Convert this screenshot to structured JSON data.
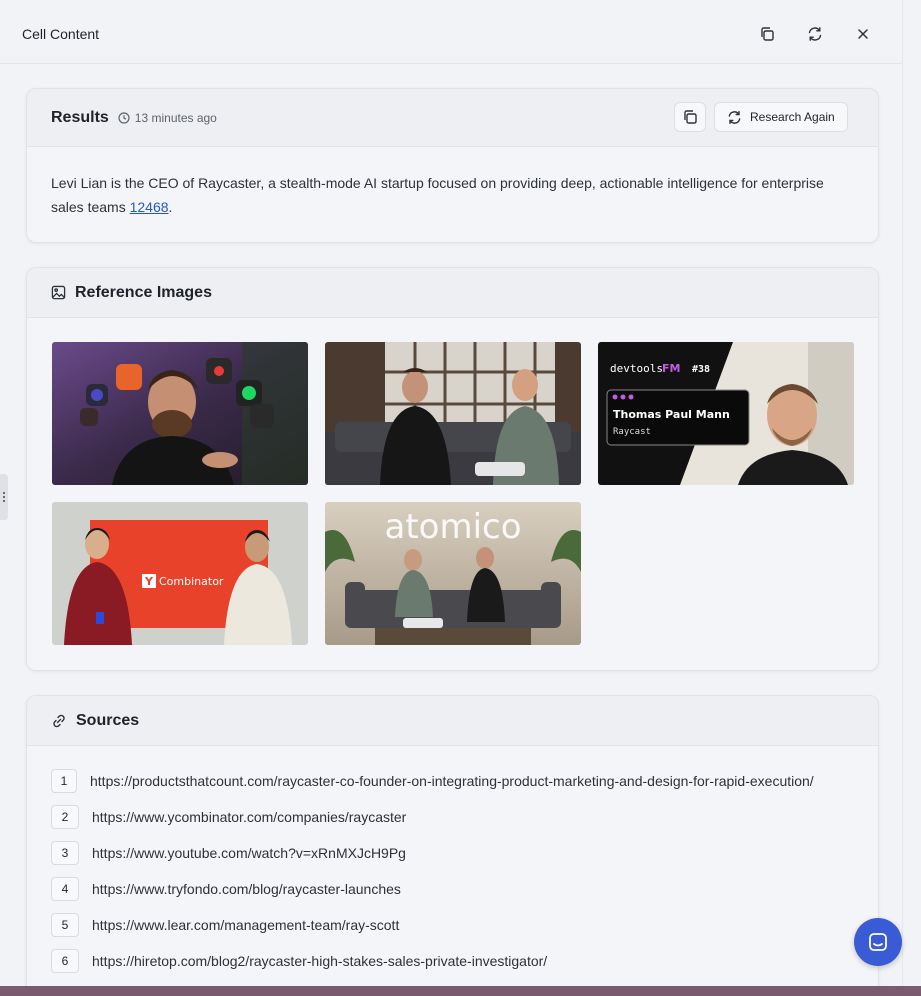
{
  "panel": {
    "title": "Cell Content"
  },
  "results": {
    "title": "Results",
    "timestamp": "13 minutes ago",
    "research_again_label": "Research Again",
    "text_before_link": "Levi Lian is the CEO of Raycaster, a stealth-mode AI startup focused on providing deep, actionable intelligence for enterprise sales teams ",
    "link_text": "12468",
    "text_after_link": "."
  },
  "reference_images": {
    "title": "Reference Images",
    "images": [
      {
        "kind": "photo",
        "icon": "person-with-app-icons-photo"
      },
      {
        "kind": "photo",
        "icon": "two-people-on-sofa-photo"
      },
      {
        "kind": "podcast-thumbnail",
        "show": "devtools",
        "show_suffix": "FM",
        "episode": "#38",
        "guest": "Thomas Paul Mann",
        "guest_company": "Raycast"
      },
      {
        "kind": "photo",
        "sign_text": "Combinator",
        "sign_letter": "Y"
      },
      {
        "kind": "photo",
        "sign_text": "atomico"
      }
    ]
  },
  "sources": {
    "title": "Sources",
    "items": [
      {
        "num": "1",
        "url": "https://productsthatcount.com/raycaster-co-founder-on-integrating-product-marketing-and-design-for-rapid-execution/"
      },
      {
        "num": "2",
        "url": "https://www.ycombinator.com/companies/raycaster"
      },
      {
        "num": "3",
        "url": "https://www.youtube.com/watch?v=xRnMXJcH9Pg"
      },
      {
        "num": "4",
        "url": "https://www.tryfondo.com/blog/raycaster-launches"
      },
      {
        "num": "5",
        "url": "https://www.lear.com/management-team/ray-scott"
      },
      {
        "num": "6",
        "url": "https://hiretop.com/blog2/raycaster-high-stakes-sales-private-investigator/"
      }
    ]
  },
  "colors": {
    "accent": "#3a5bd6",
    "link": "#2458c8",
    "yc_orange": "#e8432a"
  }
}
